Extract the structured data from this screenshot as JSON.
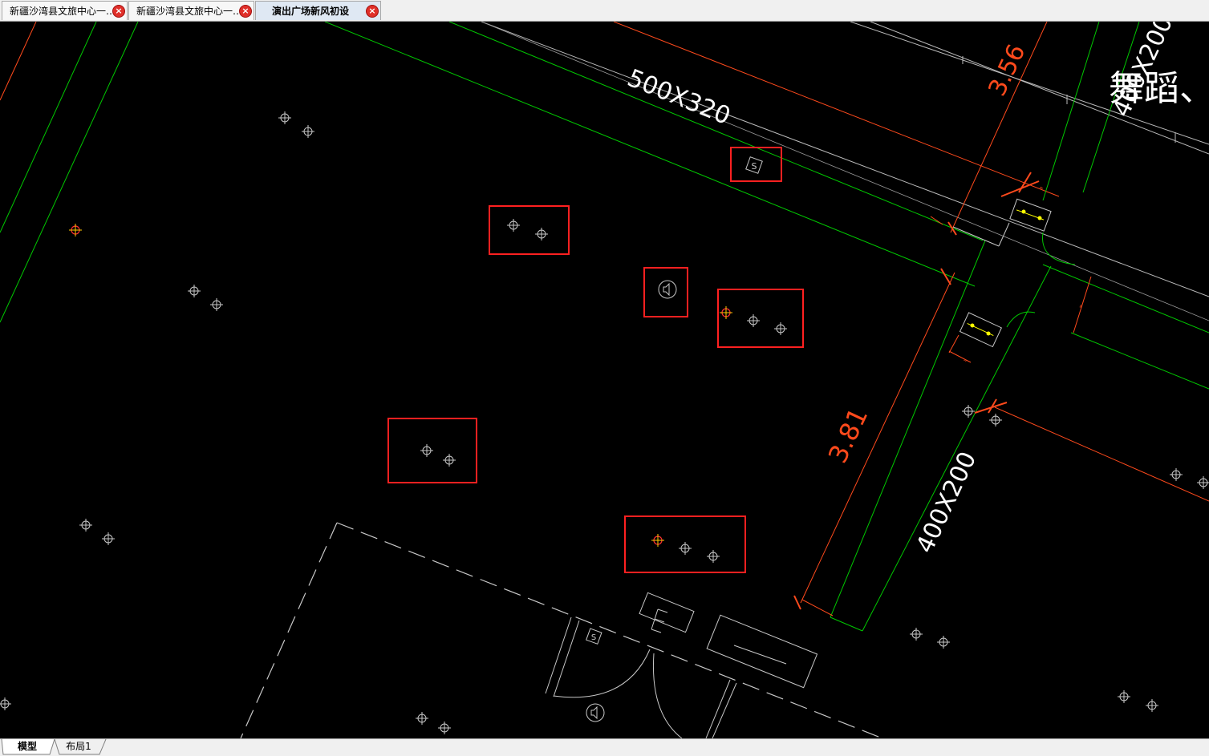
{
  "tabs": [
    {
      "label": "新疆沙湾县文旅中心一…",
      "active": false
    },
    {
      "label": "新疆沙湾县文旅中心一…",
      "active": false
    },
    {
      "label": "演出广场新风初设",
      "active": true
    }
  ],
  "close_glyph": "×",
  "drawing": {
    "duct_label_1": "500X320",
    "duct_label_2": "400X200",
    "duct_label_3": "400X200",
    "dim_1": "3.56",
    "dim_2": "3.81",
    "room_text": "舞蹈、",
    "sensor_glyph": "S",
    "tiny_dim": "≈"
  },
  "layout_tabs": [
    {
      "label": "模型",
      "active": true
    },
    {
      "label": "布局1",
      "active": false
    }
  ],
  "colors": {
    "background": "#000000",
    "green": "#00c800",
    "red": "#ff4a1c",
    "white": "#ffffff",
    "highlight": "#ff2020",
    "yellow": "#ffff00"
  }
}
